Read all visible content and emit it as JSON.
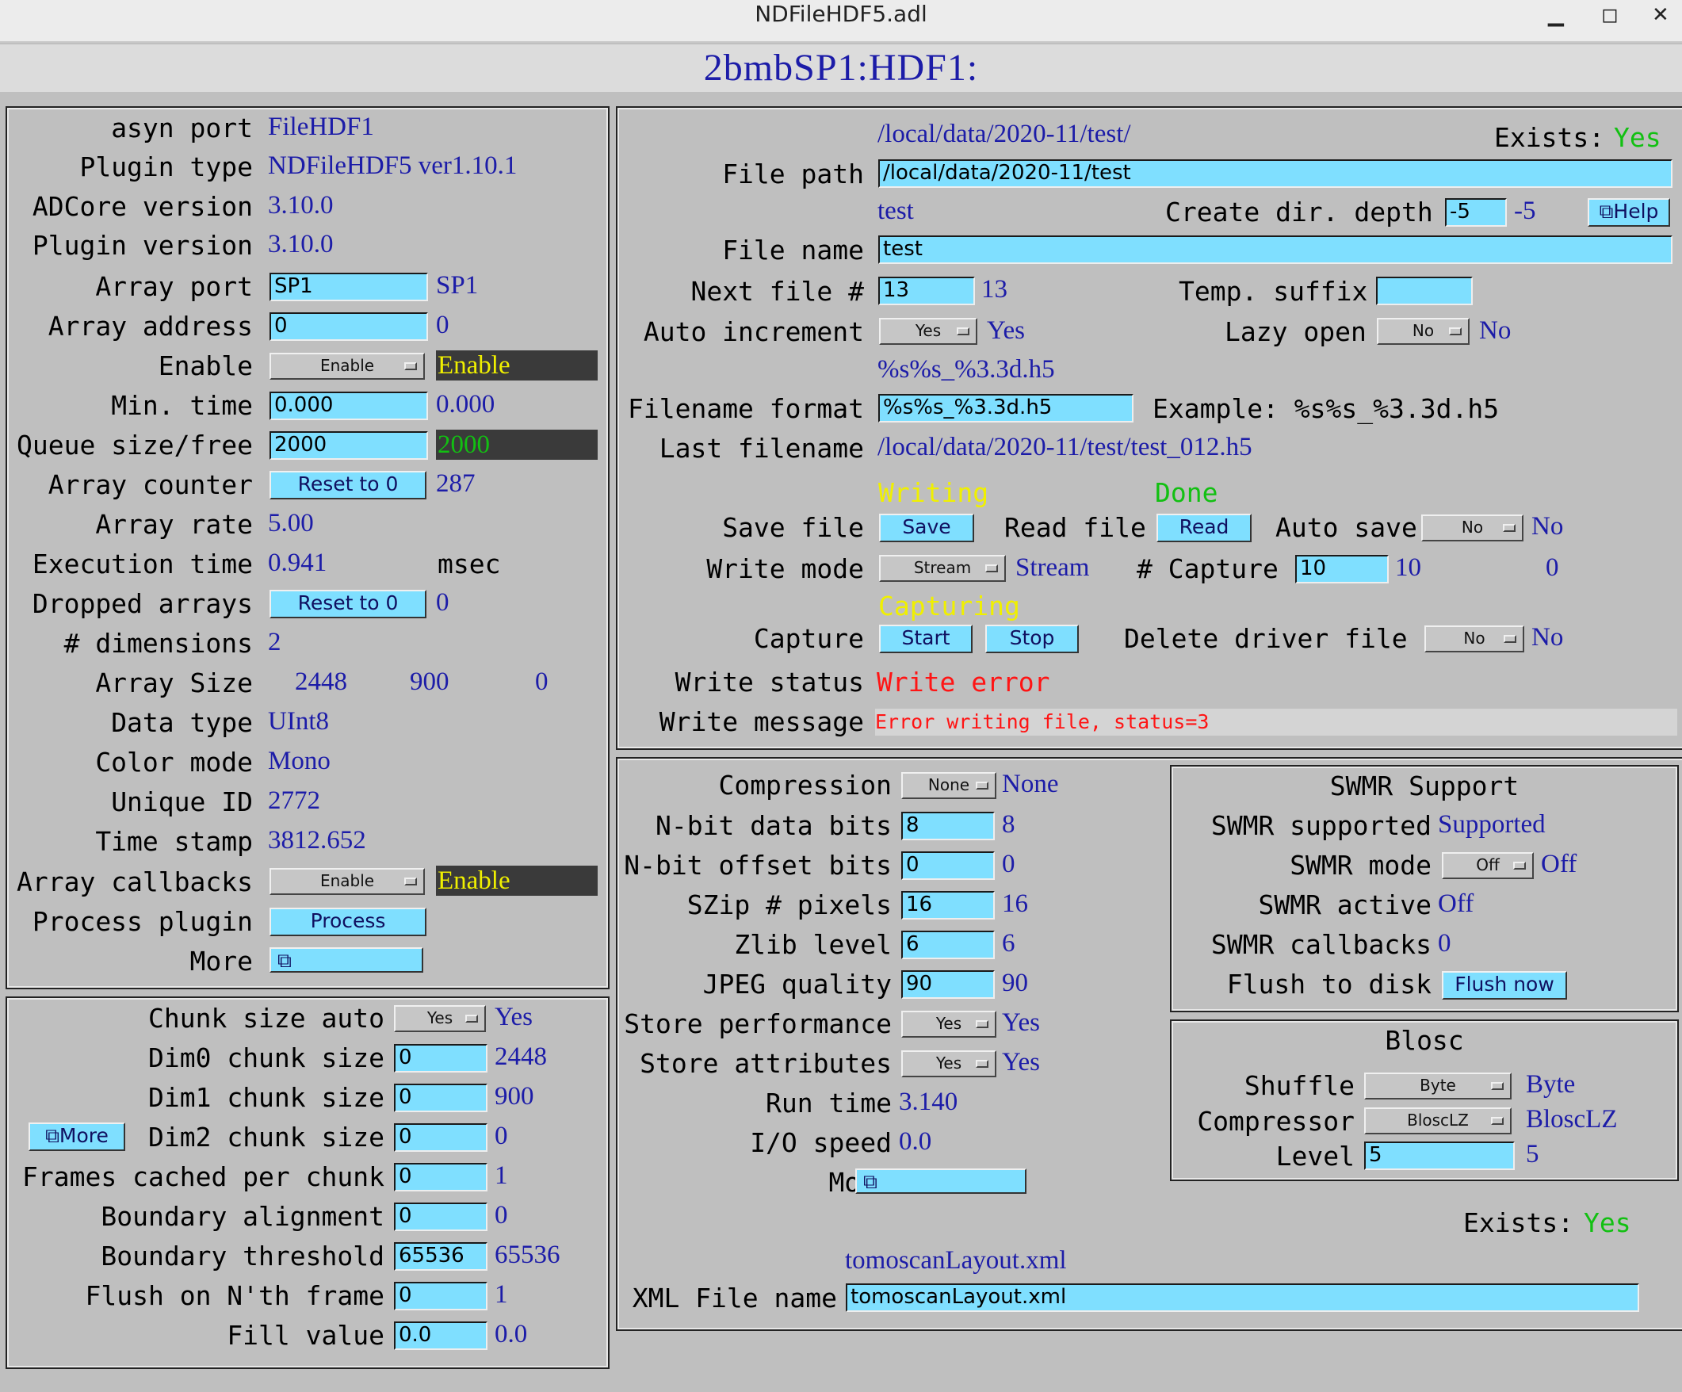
{
  "window": {
    "title": "NDFileHDF5.adl",
    "minimize": "▁",
    "maximize": "◻",
    "close": "✕"
  },
  "header": {
    "title": "2bmbSP1:HDF1:"
  },
  "left": {
    "asyn_port": {
      "label": "asyn port",
      "value": "FileHDF1"
    },
    "plugin_type": {
      "label": "Plugin type",
      "value": "NDFileHDF5 ver1.10.1"
    },
    "adcore_version": {
      "label": "ADCore version",
      "value": "3.10.0"
    },
    "plugin_version": {
      "label": "Plugin version",
      "value": "3.10.0"
    },
    "array_port": {
      "label": "Array port",
      "input": "SP1",
      "value": "SP1"
    },
    "array_address": {
      "label": "Array address",
      "input": "0",
      "value": "0"
    },
    "enable": {
      "label": "Enable",
      "menu": "Enable",
      "value": "Enable"
    },
    "min_time": {
      "label": "Min. time",
      "input": "0.000",
      "value": "0.000"
    },
    "queue": {
      "label": "Queue size/free",
      "input": "2000",
      "value": "2000"
    },
    "array_counter": {
      "label": "Array counter",
      "button": "Reset to 0",
      "value": "287"
    },
    "array_rate": {
      "label": "Array rate",
      "value": "5.00"
    },
    "execution_time": {
      "label": "Execution time",
      "value": "0.941",
      "unit": "msec"
    },
    "dropped_arrays": {
      "label": "Dropped arrays",
      "button": "Reset to 0",
      "value": "0"
    },
    "dimensions": {
      "label": "# dimensions",
      "value": "2"
    },
    "array_size": {
      "label": "Array Size",
      "v0": "2448",
      "v1": "900",
      "v2": "0"
    },
    "data_type": {
      "label": "Data type",
      "value": "UInt8"
    },
    "color_mode": {
      "label": "Color mode",
      "value": "Mono"
    },
    "unique_id": {
      "label": "Unique ID",
      "value": "2772"
    },
    "time_stamp": {
      "label": "Time stamp",
      "value": "3812.652"
    },
    "array_callbacks": {
      "label": "Array callbacks",
      "menu": "Enable",
      "value": "Enable"
    },
    "process_plugin": {
      "label": "Process plugin",
      "button": "Process"
    },
    "more": {
      "label": "More",
      "button": "⧉"
    }
  },
  "chunk": {
    "more_button": "⧉More",
    "chunk_size_auto": {
      "label": "Chunk size auto",
      "menu": "Yes",
      "value": "Yes"
    },
    "dim0": {
      "label": "Dim0 chunk size",
      "input": "0",
      "value": "2448"
    },
    "dim1": {
      "label": "Dim1 chunk size",
      "input": "0",
      "value": "900"
    },
    "dim2": {
      "label": "Dim2 chunk size",
      "input": "0",
      "value": "0"
    },
    "frames_cached": {
      "label": "Frames cached per chunk",
      "input": "0",
      "value": "1"
    },
    "boundary_alignment": {
      "label": "Boundary alignment",
      "input": "0",
      "value": "0"
    },
    "boundary_threshold": {
      "label": "Boundary threshold",
      "input": "65536",
      "value": "65536"
    },
    "flush_nth": {
      "label": "Flush on N'th frame",
      "input": "0",
      "value": "1"
    },
    "fill_value": {
      "label": "Fill value",
      "input": "0.0",
      "value": "0.0"
    }
  },
  "file": {
    "path_readback": "/local/data/2020-11/test/",
    "exists_label": "Exists:",
    "exists_value": "Yes",
    "file_path": {
      "label": "File path",
      "input": "/local/data/2020-11/test"
    },
    "name_readback": "test",
    "create_dir": {
      "label": "Create dir. depth",
      "input": "-5",
      "value": "-5"
    },
    "help_button": "⧉Help",
    "file_name": {
      "label": "File name",
      "input": "test"
    },
    "next_file": {
      "label": "Next file #",
      "input": "13",
      "value": "13"
    },
    "temp_suffix": {
      "label": "Temp. suffix",
      "input": ""
    },
    "auto_increment": {
      "label": "Auto increment",
      "menu": "Yes",
      "value": "Yes"
    },
    "lazy_open": {
      "label": "Lazy open",
      "menu": "No",
      "value": "No"
    },
    "format_readback": "%s%s_%3.3d.h5",
    "filename_format": {
      "label": "Filename format",
      "input": "%s%s_%3.3d.h5",
      "example": "Example: %s%s_%3.3d.h5"
    },
    "last_filename": {
      "label": "Last filename",
      "value": "/local/data/2020-11/test/test_012.h5"
    },
    "writing_status": "Writing",
    "done_status": "Done",
    "save_file": {
      "label": "Save file",
      "button": "Save"
    },
    "read_file": {
      "label": "Read file",
      "button": "Read"
    },
    "auto_save": {
      "label": "Auto save",
      "menu": "No",
      "value": "No"
    },
    "write_mode": {
      "label": "Write mode",
      "menu": "Stream",
      "value": "Stream"
    },
    "num_capture": {
      "label": "# Capture",
      "input": "10",
      "value": "10",
      "captured": "0"
    },
    "capturing_status": "Capturing",
    "capture": {
      "label": "Capture",
      "start": "Start",
      "stop": "Stop"
    },
    "delete_driver": {
      "label": "Delete driver file",
      "menu": "No",
      "value": "No"
    },
    "write_status": {
      "label": "Write status",
      "value": "Write error"
    },
    "write_message": {
      "label": "Write message",
      "value": "Error writing file, status=3"
    }
  },
  "compression": {
    "compression": {
      "label": "Compression",
      "menu": "None",
      "value": "None"
    },
    "nbit_data": {
      "label": "N-bit data bits",
      "input": "8",
      "value": "8"
    },
    "nbit_offset": {
      "label": "N-bit offset bits",
      "input": "0",
      "value": "0"
    },
    "szip": {
      "label": "SZip # pixels",
      "input": "16",
      "value": "16"
    },
    "zlib": {
      "label": "Zlib level",
      "input": "6",
      "value": "6"
    },
    "jpeg": {
      "label": "JPEG quality",
      "input": "90",
      "value": "90"
    },
    "store_performance": {
      "label": "Store performance",
      "menu": "Yes",
      "value": "Yes"
    },
    "store_attributes": {
      "label": "Store attributes",
      "menu": "Yes",
      "value": "Yes"
    },
    "run_time": {
      "label": "Run time",
      "value": "3.140"
    },
    "io_speed": {
      "label": "I/O speed",
      "value": "0.0"
    },
    "more": {
      "label": "More",
      "button": "⧉"
    },
    "xml_readback": "tomoscanLayout.xml",
    "xml_exists_label": "Exists:",
    "xml_exists_value": "Yes",
    "xml_file": {
      "label": "XML File name",
      "input": "tomoscanLayout.xml"
    }
  },
  "swmr": {
    "title": "SWMR Support",
    "supported": {
      "label": "SWMR supported",
      "value": "Supported"
    },
    "mode": {
      "label": "SWMR mode",
      "menu": "Off",
      "value": "Off"
    },
    "active": {
      "label": "SWMR active",
      "value": "Off"
    },
    "callbacks": {
      "label": "SWMR callbacks",
      "value": "0"
    },
    "flush": {
      "label": "Flush to disk",
      "button": "Flush now"
    }
  },
  "blosc": {
    "title": "Blosc",
    "shuffle": {
      "label": "Shuffle",
      "menu": "Byte",
      "value": "Byte"
    },
    "compressor": {
      "label": "Compressor",
      "menu": "BloscLZ",
      "value": "BloscLZ"
    },
    "level": {
      "label": "Level",
      "input": "5",
      "value": "5"
    }
  }
}
